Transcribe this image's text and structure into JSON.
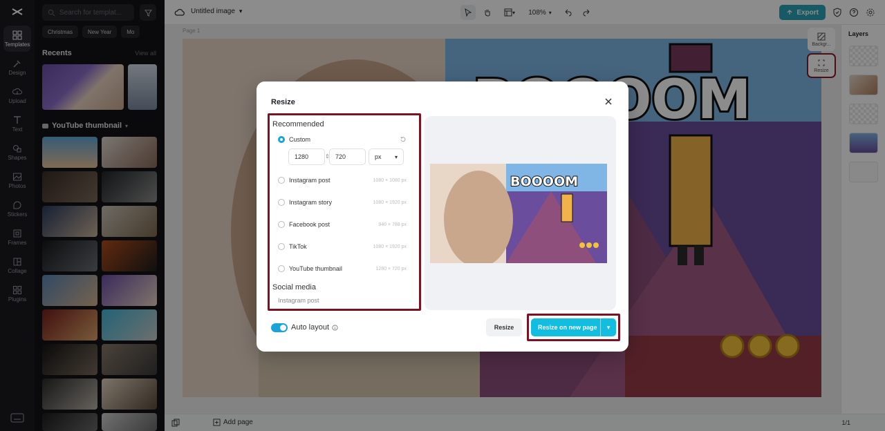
{
  "colors": {
    "accent": "#13bde0",
    "highlight": "#7a1223",
    "export": "#2aa5b8"
  },
  "rail": {
    "items": [
      {
        "label": "Templates",
        "icon": "templates-icon"
      },
      {
        "label": "Design",
        "icon": "design-icon"
      },
      {
        "label": "Upload",
        "icon": "upload-icon"
      },
      {
        "label": "Text",
        "icon": "text-icon"
      },
      {
        "label": "Shapes",
        "icon": "shapes-icon"
      },
      {
        "label": "Photos",
        "icon": "photos-icon"
      },
      {
        "label": "Stickers",
        "icon": "stickers-icon"
      },
      {
        "label": "Frames",
        "icon": "frames-icon"
      },
      {
        "label": "Collage",
        "icon": "collage-icon"
      },
      {
        "label": "Plugins",
        "icon": "plugins-icon"
      }
    ]
  },
  "templates": {
    "search_placeholder": "Search for templat...",
    "chips": [
      "Christmas",
      "New Year",
      "Mo"
    ],
    "recents_title": "Recents",
    "view_all": "View all",
    "youtube_title": "YouTube thumbnail"
  },
  "topbar": {
    "title": "Untitled image",
    "zoom": "108%",
    "export": "Export"
  },
  "canvas": {
    "page_label": "Page 1"
  },
  "tools": {
    "background": "Backgr...",
    "resize": "Resize"
  },
  "layers": {
    "title": "Layers"
  },
  "bottom": {
    "add_page": "Add page",
    "pager": "1/1"
  },
  "dialog": {
    "title": "Resize",
    "recommended": "Recommended",
    "custom": "Custom",
    "width": "1280",
    "height": "720",
    "unit": "px",
    "options": [
      {
        "label": "Instagram post",
        "dim": "1080 × 1080 px"
      },
      {
        "label": "Instagram story",
        "dim": "1080 × 1920 px"
      },
      {
        "label": "Facebook post",
        "dim": "940 × 788 px"
      },
      {
        "label": "TikTok",
        "dim": "1080 × 1920 px"
      },
      {
        "label": "YouTube thumbnail",
        "dim": "1280 × 720 px"
      }
    ],
    "social_media": "Social media",
    "social_first": "Instagram post",
    "auto_layout": "Auto layout",
    "resize_btn": "Resize",
    "resize_new_page": "Resize on new page",
    "preview_text": "BOOOOM"
  },
  "page_art": {
    "text": "BOOOOM"
  }
}
